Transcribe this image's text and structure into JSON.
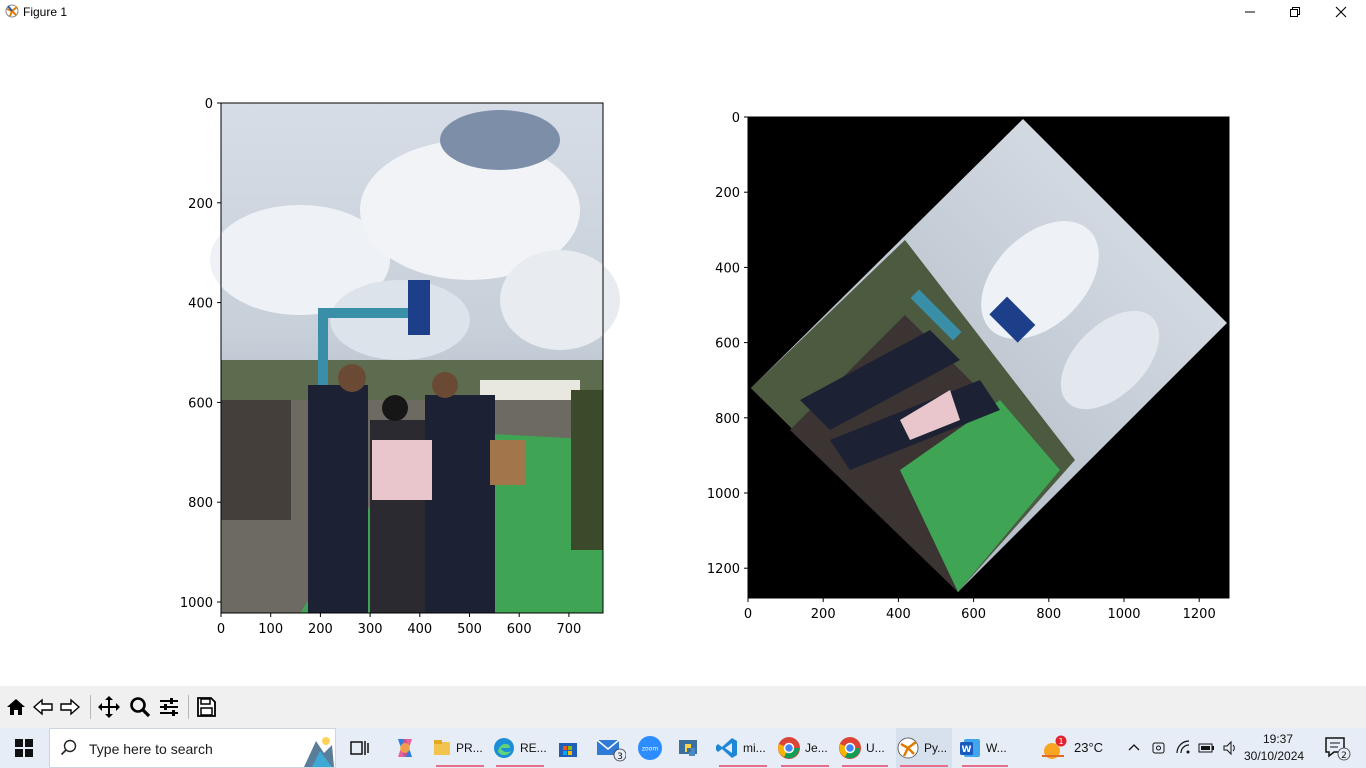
{
  "window": {
    "title": "Figure 1"
  },
  "figure": {
    "left": {
      "x_ticks": [
        "0",
        "100",
        "200",
        "300",
        "400",
        "500",
        "600",
        "700"
      ],
      "y_ticks": [
        "0",
        "200",
        "400",
        "600",
        "800",
        "1000"
      ]
    },
    "right": {
      "x_ticks": [
        "0",
        "200",
        "400",
        "600",
        "800",
        "1000",
        "1200"
      ],
      "y_ticks": [
        "0",
        "200",
        "400",
        "600",
        "800",
        "1000",
        "1200"
      ]
    }
  },
  "toolbar": {
    "buttons": [
      "home-icon",
      "back-icon",
      "forward-icon",
      "pan-icon",
      "zoom-icon",
      "configure-subplots-icon",
      "save-icon"
    ]
  },
  "taskbar": {
    "search_placeholder": "Type here to search",
    "apps": [
      {
        "name": "task-view",
        "label": ""
      },
      {
        "name": "copilot",
        "label": ""
      },
      {
        "name": "file-explorer",
        "label": "PR..."
      },
      {
        "name": "edge",
        "label": "RE..."
      },
      {
        "name": "store",
        "label": ""
      },
      {
        "name": "mail",
        "label": "",
        "badge": "3"
      },
      {
        "name": "zoom",
        "label": ""
      },
      {
        "name": "python",
        "label": ""
      },
      {
        "name": "vscode",
        "label": "mi..."
      },
      {
        "name": "chrome-1",
        "label": "Je..."
      },
      {
        "name": "chrome-2",
        "label": "U..."
      },
      {
        "name": "pyfigure",
        "label": "Py..."
      },
      {
        "name": "word",
        "label": "W..."
      }
    ],
    "weather": {
      "temp": "23°C",
      "alert_badge": "1"
    },
    "clock": {
      "time": "19:37",
      "date": "30/10/2024"
    },
    "notifications_badge": "2"
  }
}
